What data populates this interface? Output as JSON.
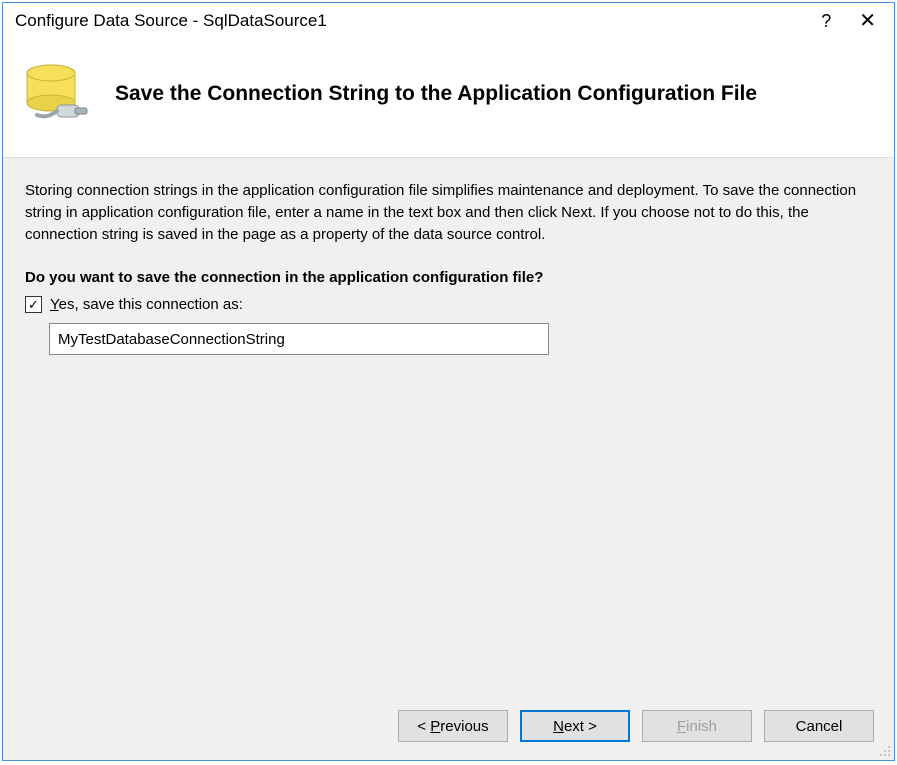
{
  "titlebar": {
    "title": "Configure Data Source - SqlDataSource1"
  },
  "header": {
    "title": "Save the Connection String to the Application Configuration File"
  },
  "body": {
    "description": "Storing connection strings in the application configuration file simplifies maintenance and deployment. To save the connection string in application configuration file, enter a name in the text box and then click Next. If you choose not to do this, the connection string is saved in the page as a property of the data source control.",
    "question": "Do you want to save the connection in the application configuration file?",
    "checkbox_label": "Yes, save this connection as:",
    "connection_name": "MyTestDatabaseConnectionString"
  },
  "footer": {
    "previous": "< Previous",
    "next": "Next >",
    "finish": "Finish",
    "cancel": "Cancel"
  }
}
